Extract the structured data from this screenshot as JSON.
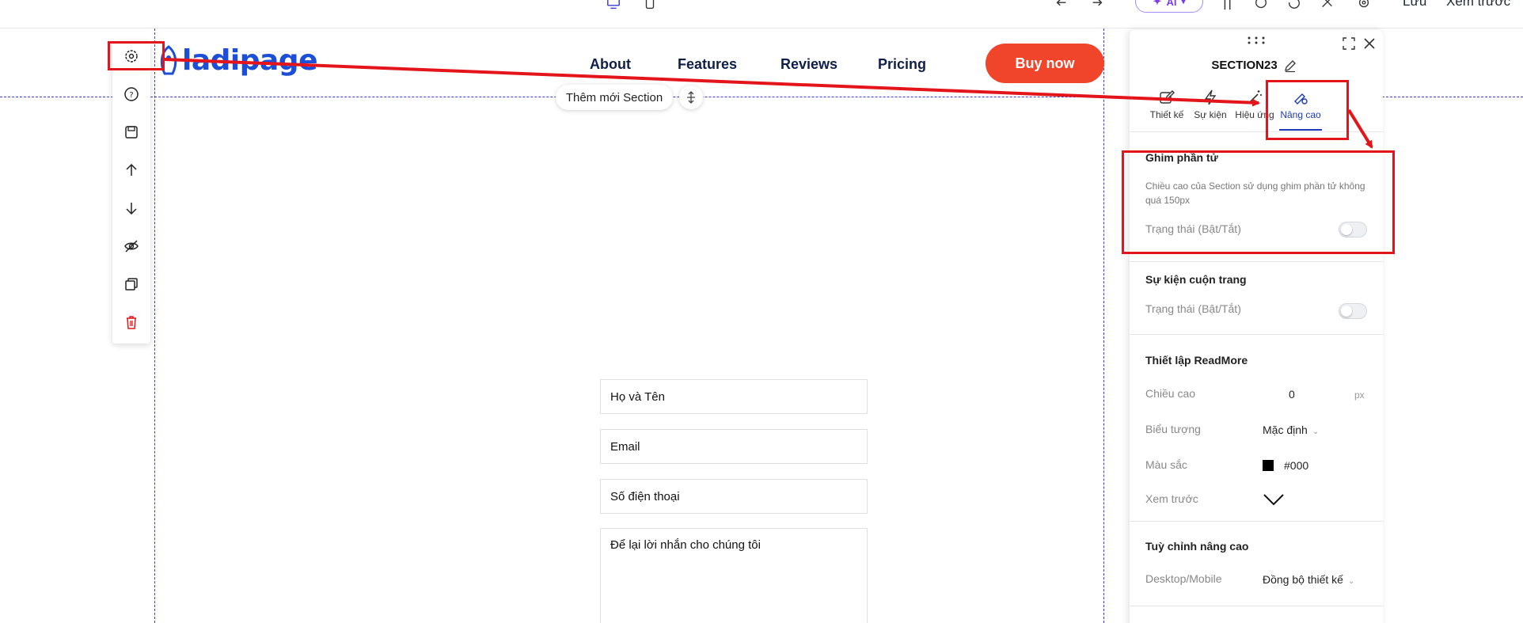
{
  "toolbar": {
    "ai_label": "AI",
    "save_label": "Lưu",
    "preview_label": "Xem trước"
  },
  "page": {
    "logo_text": "ladipage",
    "nav": [
      "About",
      "Features",
      "Reviews",
      "Pricing"
    ],
    "cta_label": "Buy now",
    "add_section_label": "Thêm mới Section"
  },
  "form": {
    "name_placeholder": "Họ và Tên",
    "email_placeholder": "Email",
    "phone_placeholder": "Số điện thoại",
    "message_placeholder": "Để lại lời nhắn cho chúng tôi"
  },
  "panel": {
    "title": "SECTION23",
    "tabs": [
      {
        "label": "Thiết kế",
        "icon": "edit-icon"
      },
      {
        "label": "Sự kiện",
        "icon": "lightning-icon"
      },
      {
        "label": "Hiệu ứng",
        "icon": "magic-wand-icon"
      },
      {
        "label": "Nâng cao",
        "icon": "advanced-settings-icon"
      }
    ],
    "active_tab": "Nâng cao",
    "pin": {
      "title": "Ghim phần tử",
      "description": "Chiều cao của Section sử dụng ghim phần tử không quá 150px",
      "status_label": "Trạng thái (Bật/Tắt)",
      "enabled": false
    },
    "scroll": {
      "title": "Sự kiện cuộn trang",
      "status_label": "Trạng thái (Bật/Tắt)",
      "enabled": false
    },
    "readmore": {
      "title": "Thiết lập ReadMore",
      "height_label": "Chiều cao",
      "height_value": "0",
      "height_unit": "px",
      "icon_label": "Biểu tượng",
      "icon_value": "Mặc định",
      "color_label": "Màu sắc",
      "color_value": "#000",
      "preview_label": "Xem trước"
    },
    "advanced": {
      "title": "Tuỳ chỉnh nâng cao",
      "device_label": "Desktop/Mobile",
      "device_value": "Đồng bộ thiết kế"
    }
  },
  "colors": {
    "accent": "#1d3bb8",
    "cta": "#f0452a",
    "annotation": "#e3141a",
    "logo": "#1d4ed8"
  }
}
